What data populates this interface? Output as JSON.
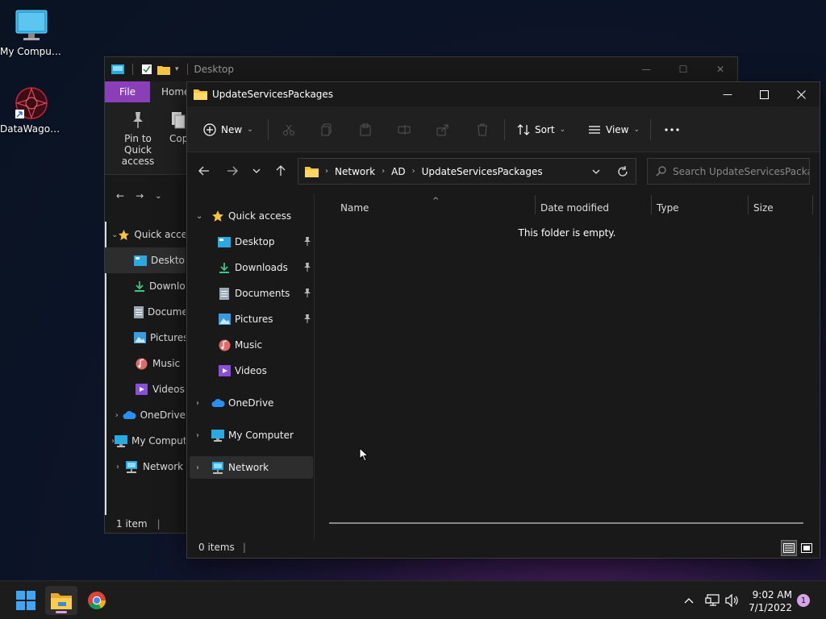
{
  "desktop": {
    "icons": [
      {
        "label": "My Computer"
      },
      {
        "label": "DataWagon..."
      }
    ]
  },
  "back_window": {
    "title": "Desktop",
    "tabs": {
      "file": "File",
      "home": "Home"
    },
    "ribbon": {
      "pin_label": "Pin to Quick access",
      "copy_label": "Copy"
    },
    "tree": [
      {
        "label": "Quick access"
      },
      {
        "label": "Desktop"
      },
      {
        "label": "Downloads"
      },
      {
        "label": "Documents"
      },
      {
        "label": "Pictures"
      },
      {
        "label": "Music"
      },
      {
        "label": "Videos"
      },
      {
        "label": "OneDrive"
      },
      {
        "label": "My Computer"
      },
      {
        "label": "Network"
      }
    ],
    "status": "1 item"
  },
  "front_window": {
    "title": "UpdateServicesPackages",
    "toolbar": {
      "new_label": "New",
      "sort_label": "Sort",
      "view_label": "View"
    },
    "breadcrumb": [
      "Network",
      "AD",
      "UpdateServicesPackages"
    ],
    "search_placeholder": "Search UpdateServicesPacka...",
    "tree": {
      "quick_access": "Quick access",
      "desktop": "Desktop",
      "downloads": "Downloads",
      "documents": "Documents",
      "pictures": "Pictures",
      "music": "Music",
      "videos": "Videos",
      "onedrive": "OneDrive",
      "my_computer": "My Computer",
      "network": "Network"
    },
    "columns": {
      "name": "Name",
      "date": "Date modified",
      "type": "Type",
      "size": "Size"
    },
    "empty_message": "This folder is empty.",
    "status": "0 items"
  },
  "taskbar": {
    "time": "9:02 AM",
    "date": "7/1/2022",
    "notifications": "1"
  },
  "colors": {
    "accent_file_tab": "#8a3fb8",
    "folder_yellow": "#f5c542",
    "notif_badge": "#d8a2e8"
  }
}
